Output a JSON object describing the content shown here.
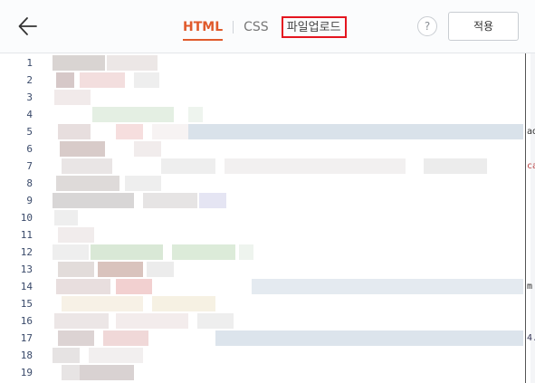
{
  "header": {
    "back_icon": "arrow-left-icon",
    "tabs": [
      {
        "label": "HTML",
        "active": true
      },
      {
        "label": "CSS",
        "active": false
      },
      {
        "label": "파일업로드",
        "active": false,
        "highlighted": true
      }
    ],
    "help_label": "?",
    "apply_label": "적용"
  },
  "editor": {
    "line_numbers": [
      "1",
      "2",
      "3",
      "4",
      "5",
      "6",
      "7",
      "8",
      "9",
      "10",
      "11",
      "12",
      "13",
      "14",
      "15",
      "16",
      "17",
      "18",
      "19"
    ],
    "edge_text": {
      "line5": "ad",
      "line7": "ca",
      "line14": "m",
      "line17": "4."
    },
    "colors": {
      "active_tab": "#e05a2b",
      "upload_border": "#e4151f",
      "line_number": "#3a4a6a"
    }
  }
}
